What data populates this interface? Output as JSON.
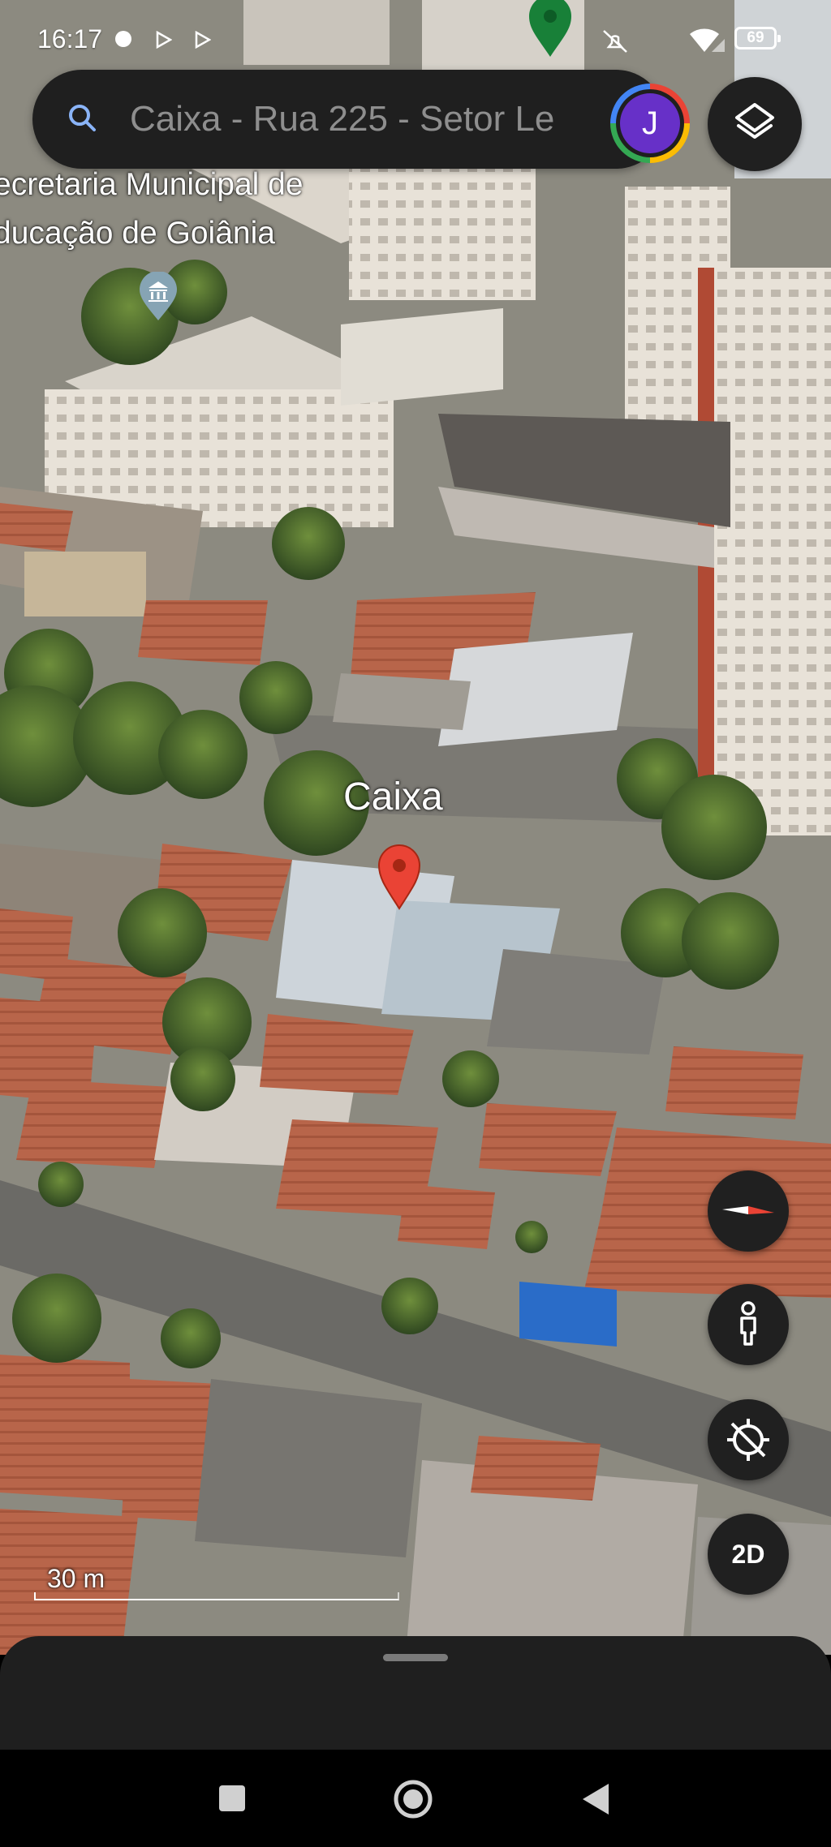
{
  "status_bar": {
    "time": "16:17",
    "battery": "69",
    "icons": [
      "notification-dot-icon",
      "play-icon",
      "play-icon",
      "map-pin-icon",
      "mute-icon",
      "wifi-icon",
      "signal-icon",
      "battery-icon"
    ]
  },
  "search": {
    "text": "Caixa - Rua 225 - Setor Le",
    "icon": "search-icon",
    "avatar_initial": "J"
  },
  "map": {
    "poi_label_line1": "ecretaria Municipal de",
    "poi_label_line2": "ducação de Goiânia",
    "poi_icon": "museum-icon",
    "place_label": "Caixa",
    "place_pin": "map-pin-icon",
    "scale_label": "30 m"
  },
  "controls": {
    "layers": "layers-icon",
    "compass": "compass-icon",
    "pegman": "pegman-icon",
    "location": "location-off-icon",
    "view_2d": "2D"
  },
  "colors": {
    "surface": "#1f1f1f",
    "avatar": "#6730c8",
    "pin": "#ea4335"
  }
}
